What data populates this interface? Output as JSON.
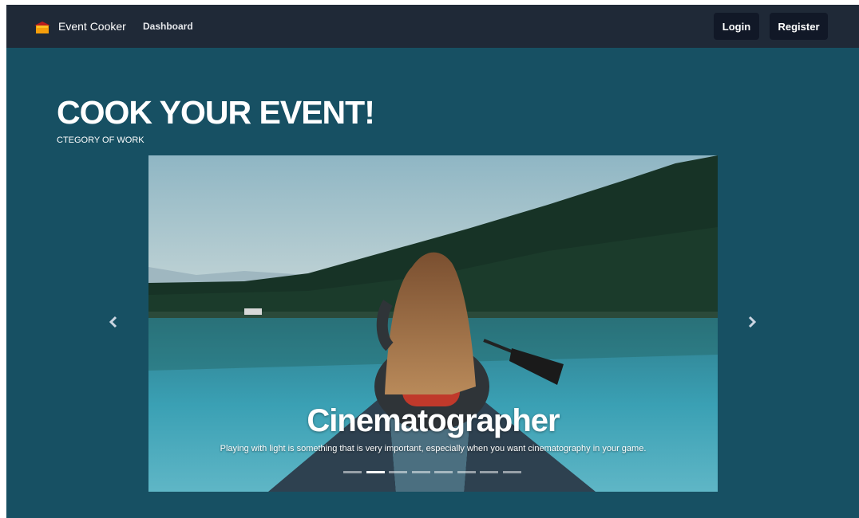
{
  "navbar": {
    "brand": "Event Cooker",
    "brand_icon": "house-icon",
    "links": [
      "Dashboard"
    ],
    "login_label": "Login",
    "register_label": "Register",
    "background": "#1f2937"
  },
  "hero": {
    "title": "COOK YOUR EVENT!",
    "subtitle": "CTEGORY OF WORK",
    "background": "#175063"
  },
  "carousel": {
    "slide": {
      "title": "Cinematographer",
      "description": "Playing with light is something that is very important, especially when you want cinematography in your game."
    },
    "indicator_count": 8,
    "active_indicator": 1,
    "prev_icon": "chevron-left-icon",
    "next_icon": "chevron-right-icon"
  }
}
